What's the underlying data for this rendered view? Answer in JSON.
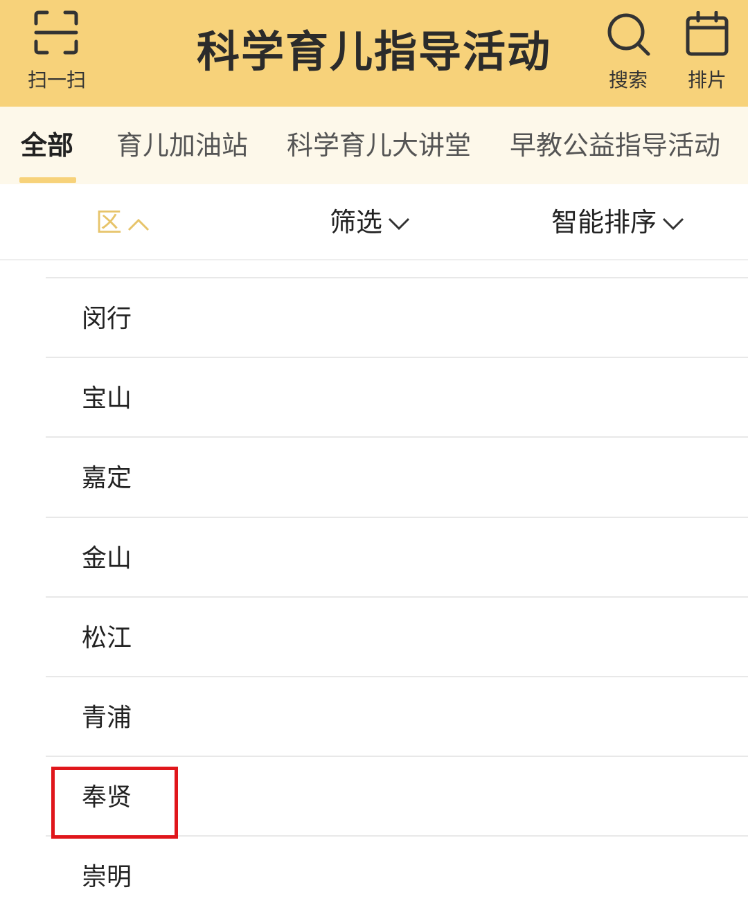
{
  "header": {
    "scan_label": "扫一扫",
    "title": "科学育儿指导活动",
    "search_label": "搜索",
    "schedule_label": "排片",
    "background_color": "#f7d27a"
  },
  "tabs": [
    {
      "label": "全部",
      "active": true
    },
    {
      "label": "育儿加油站",
      "active": false
    },
    {
      "label": "科学育儿大讲堂",
      "active": false
    },
    {
      "label": "早教公益指导活动",
      "active": false
    }
  ],
  "filters": {
    "district": "区",
    "filter": "筛选",
    "sort": "智能排序"
  },
  "districts": [
    "闵行",
    "宝山",
    "嘉定",
    "金山",
    "松江",
    "青浦",
    "奉贤",
    "崇明"
  ],
  "highlighted_district": "奉贤",
  "colors": {
    "accent": "#f7d27a",
    "district_active": "#e7c46a",
    "highlight": "#e0161b"
  },
  "icons": {
    "scan": "scan-icon",
    "search": "search-icon",
    "calendar": "calendar-icon",
    "chevron_up": "chevron-up-icon",
    "chevron_down": "chevron-down-icon"
  }
}
